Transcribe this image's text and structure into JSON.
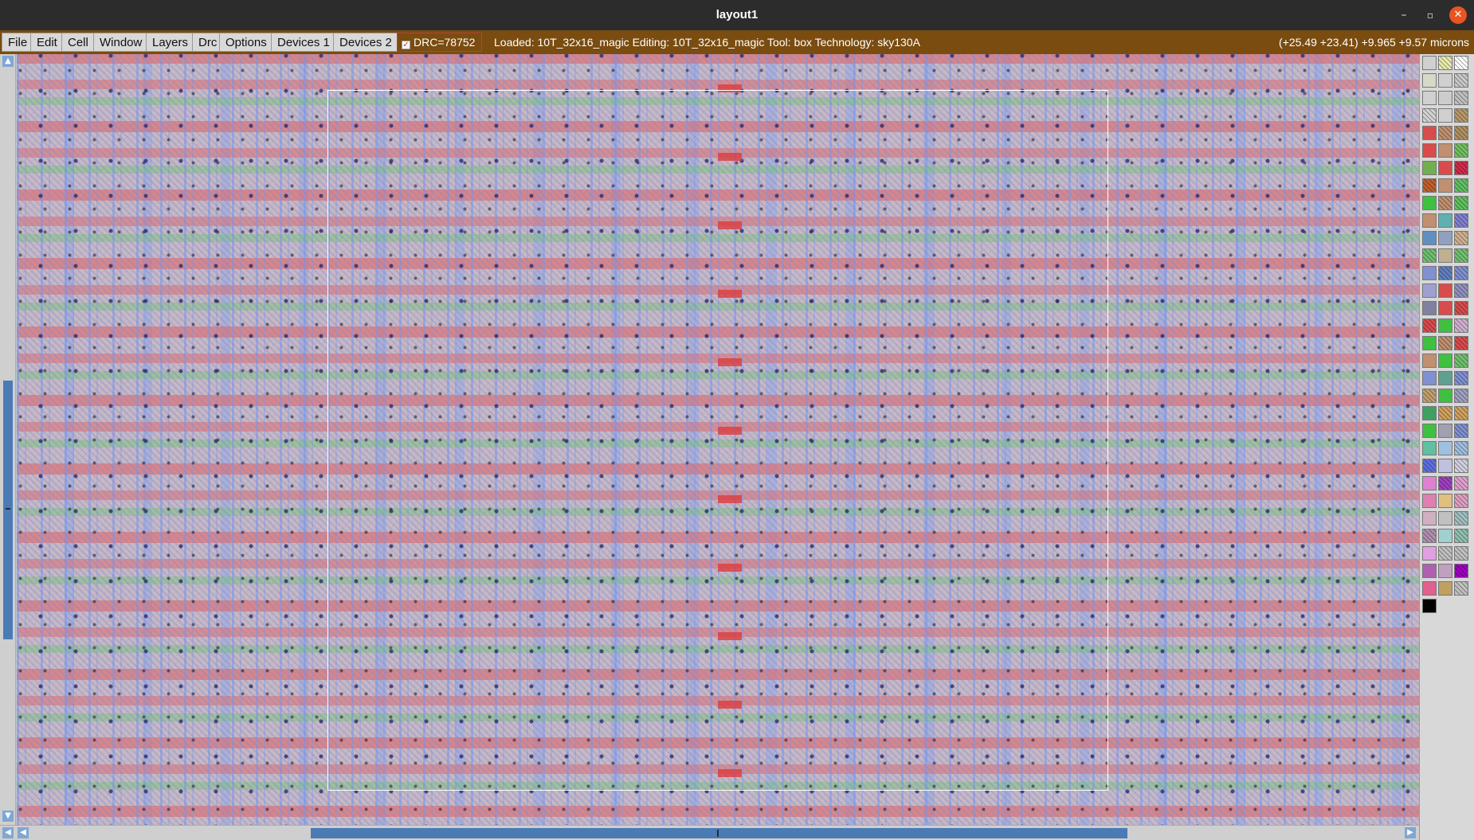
{
  "window": {
    "title": "layout1",
    "controls": {
      "minimize": "–",
      "maximize": "▫",
      "close": "✕"
    }
  },
  "menu": {
    "items": [
      "File",
      "Edit",
      "Cell",
      "Window",
      "Layers",
      "Drc",
      "Options",
      "Devices 1",
      "Devices 2"
    ]
  },
  "drc": {
    "checked": true,
    "label": "DRC=78752"
  },
  "status": {
    "text": "Loaded: 10T_32x16_magic Editing: 10T_32x16_magic Tool: box  Technology: sky130A",
    "coords": "(+25.49 +23.41) +9.965 +9.57 microns"
  },
  "canvas": {
    "description_colors": {
      "background": "#c6b9c6",
      "metal1": "#7896eb",
      "poly": "#e16969",
      "diff": "#6ec86e",
      "box": "#ffffff"
    }
  },
  "palette": {
    "swatches": [
      "#d0d0d0",
      "#e8e8b0",
      "#ffffff",
      "#d8d8c8",
      "#d0d0d0",
      "#c8c8c8",
      "#d0d0d0",
      "#cccccc",
      "#c0c0c0",
      "#d4d4d4",
      "#d0d0d0",
      "#b89868",
      "#d94c4c",
      "#c09070",
      "#b09060",
      "#d94c4c",
      "#c09070",
      "#70c060",
      "#70b050",
      "#d94c4c",
      "#d02c4c",
      "#c06030",
      "#c09070",
      "#60c060",
      "#40c040",
      "#c09070",
      "#60c060",
      "#c09070",
      "#60b0b0",
      "#8080d0",
      "#6090c0",
      "#90a0c0",
      "#d0b090",
      "#70c070",
      "#c0b090",
      "#70c070",
      "#8090d0",
      "#6080c0",
      "#8090d0",
      "#a0a0d0",
      "#d94c4c",
      "#9090c0",
      "#8080a0",
      "#d94c4c",
      "#d94c4c",
      "#d94c4c",
      "#40c040",
      "#d0b0d0",
      "#40c040",
      "#c09070",
      "#d94c4c",
      "#c09070",
      "#40c040",
      "#70c070",
      "#8090d0",
      "#60a090",
      "#8090d0",
      "#c0a070",
      "#40c040",
      "#a0a0c0",
      "#40a060",
      "#d0a060",
      "#d0a060",
      "#40c040",
      "#a0a0b0",
      "#8090d0",
      "#60c0a0",
      "#a0c0e0",
      "#a0c0e0",
      "#6070e0",
      "#c0c0e0",
      "#d0d0e0",
      "#e080d0",
      "#a040c0",
      "#e0a0d0",
      "#e080b0",
      "#e0c080",
      "#e0a0c0",
      "#d0b0c0",
      "#c0c0c0",
      "#a0c0c0",
      "#b090b0",
      "#a0d0d0",
      "#90c0b0",
      "#e0a0e0",
      "#c0c0c0",
      "#c0c0c0",
      "#b060b0",
      "#c0a0c0",
      "#a000c0",
      "#e06090",
      "#c0a060",
      "#c0c0c0",
      "#000000"
    ]
  }
}
